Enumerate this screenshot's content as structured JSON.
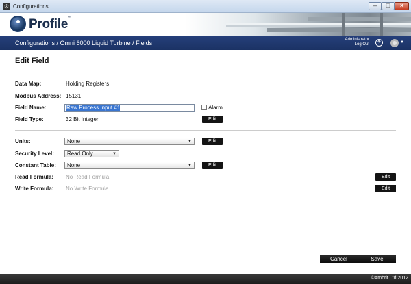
{
  "window": {
    "title": "Configurations"
  },
  "brand": {
    "name": "Profile",
    "tm": "™"
  },
  "nav": {
    "breadcrumb": "Configurations / Omni 6000 Liquid Turbine / Fields",
    "user": "Administrator",
    "logout": "Log Out",
    "help": "?"
  },
  "page": {
    "title": "Edit Field"
  },
  "form": {
    "data_map_label": "Data Map:",
    "data_map_value": "Holding Registers",
    "modbus_label": "Modbus Address:",
    "modbus_value": "15131",
    "field_name_label": "Field Name:",
    "field_name_value": "Raw Process Input #1",
    "alarm_label": "Alarm",
    "field_type_label": "Field Type:",
    "field_type_value": "32 Bit Integer",
    "units_label": "Units:",
    "units_value": "None",
    "security_label": "Security Level:",
    "security_value": "Read Only",
    "constant_label": "Constant Table:",
    "constant_value": "None",
    "read_formula_label": "Read Formula:",
    "read_formula_value": "No Read Formula",
    "write_formula_label": "Write Formula:",
    "write_formula_value": "No Write Formula",
    "edit_label": "Edit"
  },
  "footer": {
    "cancel": "Cancel",
    "save": "Save"
  },
  "status": {
    "copyright": "©Ambrit Ltd 2012"
  },
  "colors": {
    "nav": "#1f3a72",
    "button": "#141414",
    "selection": "#3a76d1"
  }
}
